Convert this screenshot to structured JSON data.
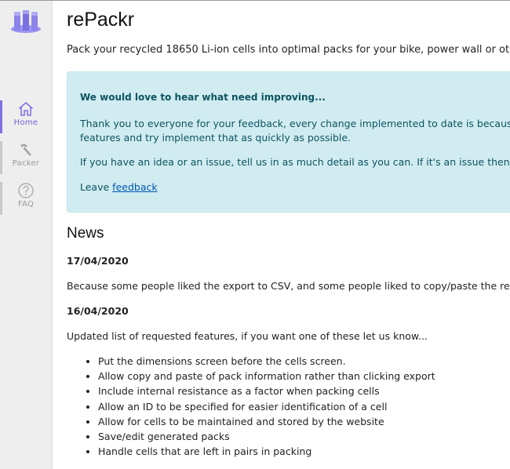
{
  "app": {
    "title": "rePackr",
    "tagline": "Pack your recycled 18650 Li-ion cells into optimal packs for your bike, power wall or other"
  },
  "sidebar": {
    "logo_icon": "books-logo-icon",
    "items": [
      {
        "label": "Home",
        "icon": "home-icon",
        "active": true
      },
      {
        "label": "Packer",
        "icon": "hammer-icon",
        "active": false
      },
      {
        "label": "FAQ",
        "icon": "question-circle-icon",
        "active": false
      }
    ]
  },
  "alert": {
    "title": "We would love to hear what need improving...",
    "paragraph1_line1": "Thank you to everyone for your feedback, every change implemented to date is because",
    "paragraph1_line2": "features and try implement that as quickly as possible.",
    "paragraph2": "If you have an idea or an issue, tell us in as much detail as you can. If it's an issue then",
    "leave_text": "Leave",
    "feedback_link": "feedback"
  },
  "news": {
    "heading": "News",
    "entries": [
      {
        "date": "17/04/2020",
        "text": "Because some people liked the export to CSV, and some people liked to copy/paste the res"
      },
      {
        "date": "16/04/2020",
        "text": "Updated list of requested features, if you want one of these let us know..."
      }
    ],
    "features": [
      "Put the dimensions screen before the cells screen.",
      "Allow copy and paste of pack information rather than clicking export",
      "Include internal resistance as a factor when packing cells",
      "Allow an ID to be specified for easier identification of a cell",
      "Allow for cells to be maintained and stored by the website",
      "Save/edit generated packs",
      "Handle cells that are left in pairs in packing"
    ]
  },
  "colors": {
    "accent": "#7e72e3",
    "alert_bg": "#d1ecf1",
    "alert_text": "#0c5460",
    "sidebar_bg": "#eeeeee"
  }
}
